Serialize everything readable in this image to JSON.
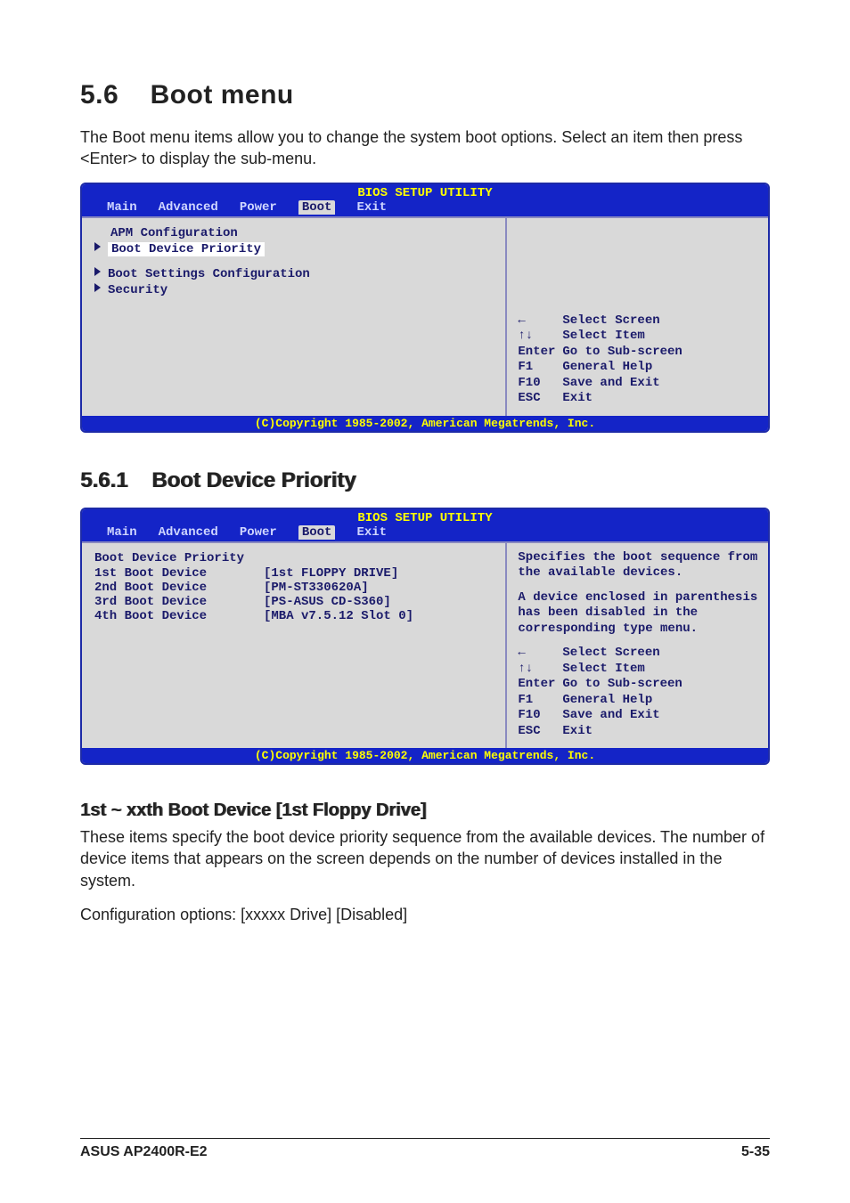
{
  "section": {
    "number": "5.6",
    "title": "Boot menu",
    "desc": "The Boot menu items allow you to change the system boot options. Select an item then press <Enter> to display the sub-menu."
  },
  "bios1": {
    "title": "BIOS SETUP UTILITY",
    "menu": [
      "Main",
      "Advanced",
      "Power",
      "Boot",
      "Exit"
    ],
    "active_index": 3,
    "left_plain_top": "APM Configuration",
    "left_selected": "Boot Device Priority",
    "left_sub1": "Boot Settings Configuration",
    "left_sub2": "Security",
    "nav": {
      "arrows_lr": "←",
      "arrows_lr_label": "Select Screen",
      "arrows_ud": "↑↓",
      "arrows_ud_label": "Select Item",
      "enter": "Enter",
      "enter_label": "Go to Sub-screen",
      "f1": "F1",
      "f1_label": "General Help",
      "f10": "F10",
      "f10_label": "Save and Exit",
      "esc": "ESC",
      "esc_label": "Exit"
    },
    "footer": "(C)Copyright 1985-2002, American Megatrends, Inc."
  },
  "subsection": {
    "number": "5.6.1",
    "title": "Boot Device Priority"
  },
  "bios2": {
    "title": "BIOS SETUP UTILITY",
    "menu": [
      "Main",
      "Advanced",
      "Power",
      "Boot",
      "Exit"
    ],
    "active_index": 3,
    "heading": "Boot Device Priority",
    "rows": [
      {
        "label": "1st Boot Device",
        "value": "[1st FLOPPY DRIVE]"
      },
      {
        "label": "2nd Boot Device",
        "value": "[PM-ST330620A]"
      },
      {
        "label": "3rd Boot Device",
        "value": "[PS-ASUS CD-S360]"
      },
      {
        "label": "4th Boot Device",
        "value": "[MBA v7.5.12 Slot 0]"
      }
    ],
    "help1": "Specifies the boot sequence from the available devices.",
    "help2": "A device enclosed in parenthesis has been disabled in the corresponding type menu.",
    "nav": {
      "arrows_lr": "←",
      "arrows_lr_label": "Select Screen",
      "arrows_ud": "↑↓",
      "arrows_ud_label": "Select Item",
      "enter": "Enter",
      "enter_label": "Go to Sub-screen",
      "f1": "F1",
      "f1_label": "General Help",
      "f10": "F10",
      "f10_label": "Save and Exit",
      "esc": "ESC",
      "esc_label": "Exit"
    },
    "footer": "(C)Copyright 1985-2002, American Megatrends, Inc."
  },
  "field": {
    "heading": "1st ~ xxth Boot Device [1st Floppy Drive]",
    "p1": "These items specify the boot device priority sequence from the available devices. The number of device items that appears on the screen depends on the number of devices installed in the system.",
    "p2": "Configuration options: [xxxxx Drive] [Disabled]"
  },
  "footer": {
    "left": "ASUS AP2400R-E2",
    "right": "5-35"
  }
}
